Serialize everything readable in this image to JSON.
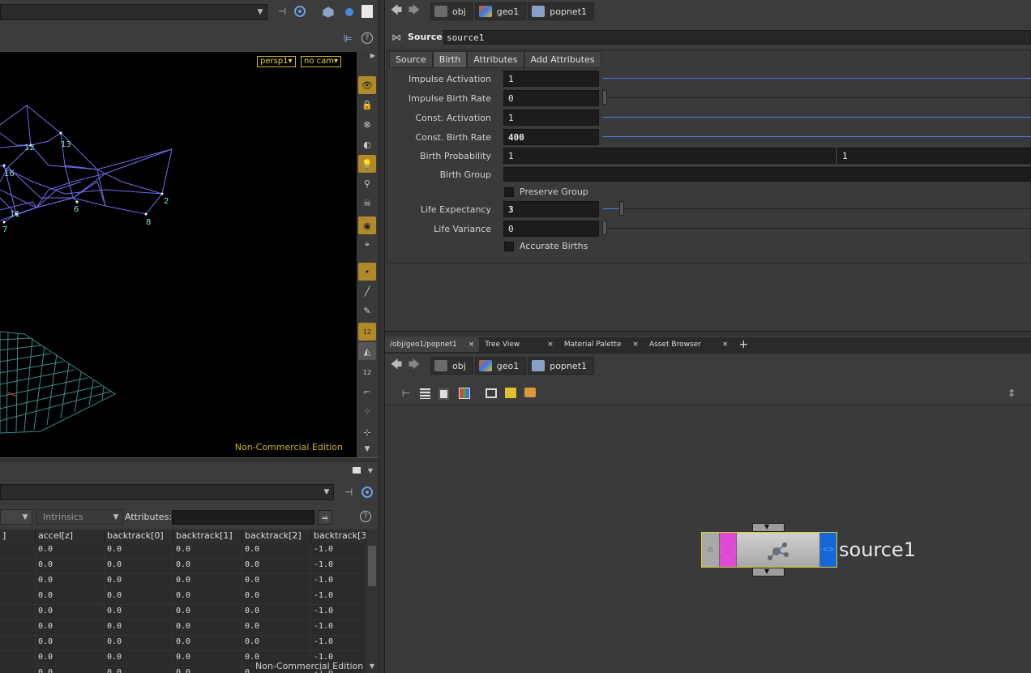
{
  "viewport": {
    "camera_label": "persp1▾",
    "cam_label": "no cam▾",
    "watermark": "Non-Commercial Edition",
    "point_numbers": [
      "12",
      "13",
      "16",
      "2",
      "6",
      "11",
      "7",
      "8"
    ],
    "toolbar_badge_1": "12",
    "toolbar_badge_2": "12"
  },
  "spreadsheet": {
    "intrinsics_label": "Intrinsics",
    "attributes_label": "Attributes:",
    "attributes_value": "",
    "columns": [
      "]",
      "accel[z]",
      "backtrack[0]",
      "backtrack[1]",
      "backtrack[2]",
      "backtrack[3"
    ],
    "rows": [
      [
        "",
        "0.0",
        "0.0",
        "0.0",
        "0.0",
        "-1.0"
      ],
      [
        "",
        "0.0",
        "0.0",
        "0.0",
        "0.0",
        "-1.0"
      ],
      [
        "",
        "0.0",
        "0.0",
        "0.0",
        "0.0",
        "-1.0"
      ],
      [
        "",
        "0.0",
        "0.0",
        "0.0",
        "0.0",
        "-1.0"
      ],
      [
        "",
        "0.0",
        "0.0",
        "0.0",
        "0.0",
        "-1.0"
      ],
      [
        "",
        "0.0",
        "0.0",
        "0.0",
        "0.0",
        "-1.0"
      ],
      [
        "",
        "0.0",
        "0.0",
        "0.0",
        "0.0",
        "-1.0"
      ],
      [
        "",
        "0.0",
        "0.0",
        "0.0",
        "0.0",
        "-1.0"
      ],
      [
        "",
        "0.0",
        "0.0",
        "0.0",
        "0.",
        "-1.0"
      ]
    ],
    "watermark": "Non-Commercial Edition"
  },
  "params": {
    "breadcrumb": [
      "obj",
      "geo1",
      "popnet1"
    ],
    "node_type": "Source",
    "node_name": "source1",
    "tabs": [
      "Source",
      "Birth",
      "Attributes",
      "Add Attributes"
    ],
    "selected_tab": "Birth",
    "fields": {
      "impulse_activation": {
        "label": "Impulse Activation",
        "value": "1"
      },
      "impulse_birth_rate": {
        "label": "Impulse Birth Rate",
        "value": "0"
      },
      "const_activation": {
        "label": "Const. Activation",
        "value": "1"
      },
      "const_birth_rate": {
        "label": "Const. Birth Rate",
        "value": "400"
      },
      "birth_probability": {
        "label": "Birth Probability",
        "value": "1",
        "value2": "1"
      },
      "birth_group": {
        "label": "Birth Group",
        "value": ""
      },
      "preserve_group": {
        "label": "Preserve Group"
      },
      "life_expectancy": {
        "label": "Life Expectancy",
        "value": "3"
      },
      "life_variance": {
        "label": "Life Variance",
        "value": "0"
      },
      "accurate_births": {
        "label": "Accurate Births"
      }
    }
  },
  "network": {
    "tabs": [
      {
        "label": "/obj/geo1/popnet1",
        "close": "×"
      },
      {
        "label": "Tree View",
        "close": "×"
      },
      {
        "label": "Material Palette",
        "close": "×"
      },
      {
        "label": "Asset Browser",
        "close": "×"
      }
    ],
    "add_tab": "+",
    "breadcrumb": [
      "obj",
      "geo1",
      "popnet1"
    ],
    "node_label": "source1",
    "node_colors": {
      "flag_left": "#a0a0a0",
      "flag_pink": "#e04bd6",
      "flag_blue": "#1668d8",
      "body": "#bdbdbd"
    }
  }
}
